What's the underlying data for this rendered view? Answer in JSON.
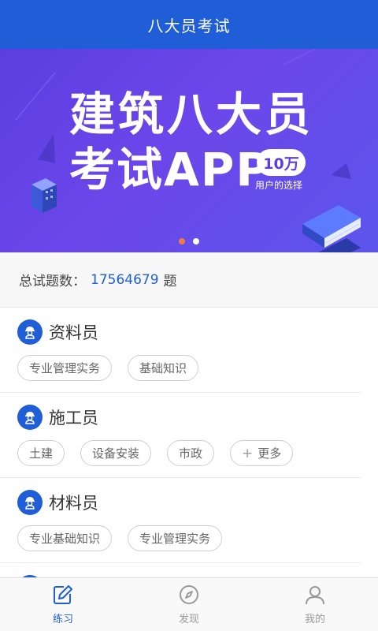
{
  "header": {
    "title": "八大员考试"
  },
  "banner": {
    "line1": "建筑八大员",
    "line2": "考试APP",
    "badge": "10万",
    "badge_sub": "用户的选择",
    "slides": 2,
    "active_slide": 0
  },
  "total": {
    "label": "总试题数：",
    "count": "17564679",
    "unit": "题"
  },
  "categories": [
    {
      "name": "资料员",
      "tags": [
        "专业管理实务",
        "基础知识"
      ]
    },
    {
      "name": "施工员",
      "tags": [
        "土建",
        "设备安装",
        "市政"
      ],
      "more": "更多"
    },
    {
      "name": "材料员",
      "tags": [
        "专业基础知识",
        "专业管理实务"
      ]
    }
  ],
  "nav": [
    {
      "label": "练习",
      "icon": "edit-icon",
      "active": true
    },
    {
      "label": "发现",
      "icon": "compass-icon",
      "active": false
    },
    {
      "label": "我的",
      "icon": "user-icon",
      "active": false
    }
  ],
  "colors": {
    "primary": "#1f5ed6",
    "banner": "#6245e6",
    "dot_active": "#f27a4a"
  }
}
